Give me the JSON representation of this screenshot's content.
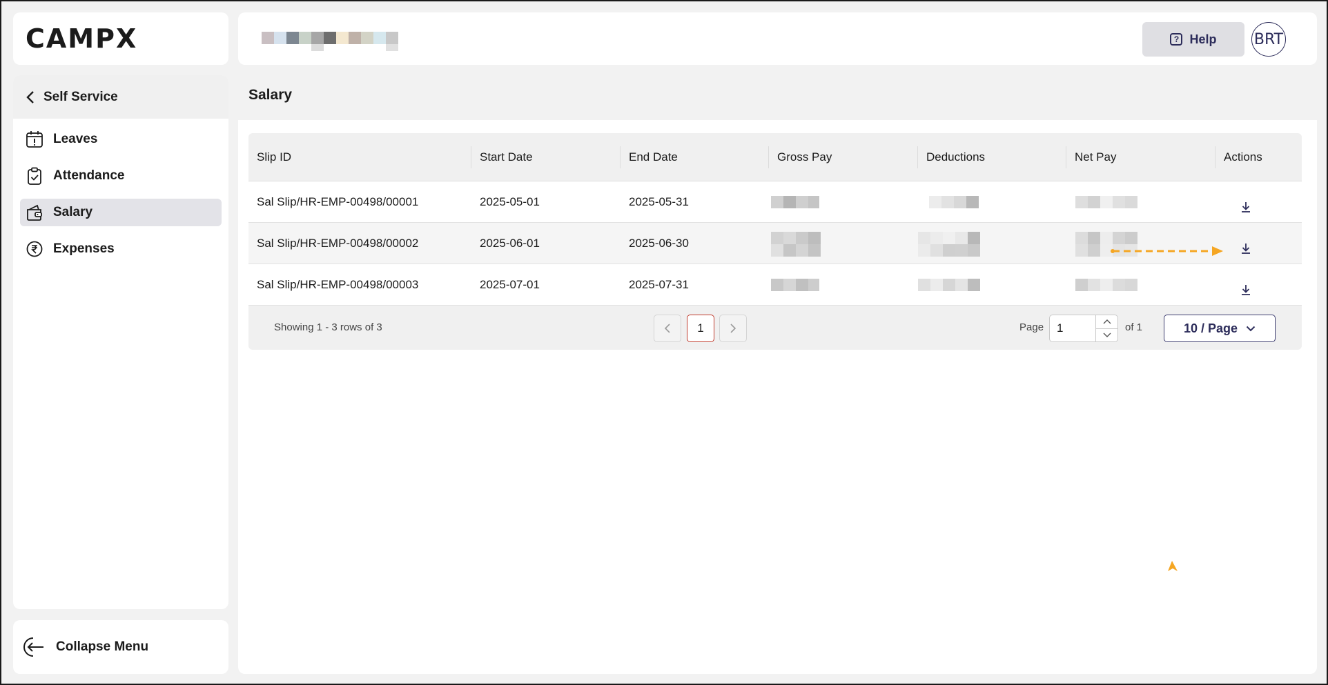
{
  "logo": {
    "text": "CAMPX"
  },
  "header": {
    "help_label": "Help",
    "avatar_initials": "BRT"
  },
  "sidebar": {
    "back_label": "Self Service",
    "items": [
      {
        "label": "Leaves",
        "icon": "calendar-alert-icon",
        "active": false
      },
      {
        "label": "Attendance",
        "icon": "clipboard-check-icon",
        "active": false
      },
      {
        "label": "Salary",
        "icon": "wallet-icon",
        "active": true
      },
      {
        "label": "Expenses",
        "icon": "rupee-circle-icon",
        "active": false
      }
    ],
    "collapse_label": "Collapse Menu"
  },
  "page": {
    "title": "Salary"
  },
  "table": {
    "columns": [
      "Slip ID",
      "Start Date",
      "End Date",
      "Gross Pay",
      "Deductions",
      "Net Pay",
      "Actions"
    ],
    "rows": [
      {
        "slip_id": "Sal Slip/HR-EMP-00498/00001",
        "start_date": "2025-05-01",
        "end_date": "2025-05-31"
      },
      {
        "slip_id": "Sal Slip/HR-EMP-00498/00002",
        "start_date": "2025-06-01",
        "end_date": "2025-06-30"
      },
      {
        "slip_id": "Sal Slip/HR-EMP-00498/00003",
        "start_date": "2025-07-01",
        "end_date": "2025-07-31"
      }
    ]
  },
  "pagination": {
    "showing": "Showing 1 - 3 rows of 3",
    "current_page": "1",
    "page_label": "Page",
    "page_input": "1",
    "of_label": "of 1",
    "per_page": "10 / Page"
  },
  "colors": {
    "accent": "#2c2c5a",
    "active_page_border": "#c0392b",
    "annotation": "#f5a623"
  }
}
